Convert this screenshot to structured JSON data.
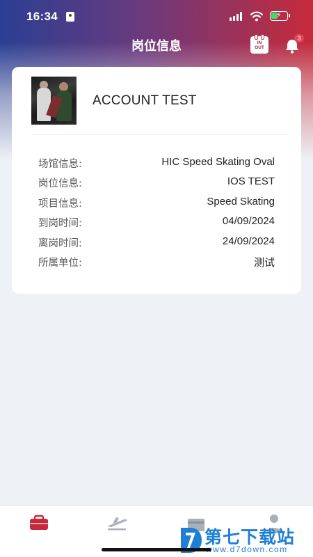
{
  "status_bar": {
    "time": "16:34"
  },
  "header": {
    "title": "岗位信息",
    "calendar_icon_text_top": "IN",
    "calendar_icon_text_bottom": "OUT",
    "notification_count": "3"
  },
  "profile": {
    "name": "ACCOUNT TEST"
  },
  "info": [
    {
      "label": "场馆信息:",
      "value": "HIC Speed Skating Oval"
    },
    {
      "label": "岗位信息:",
      "value": "IOS TEST"
    },
    {
      "label": "项目信息:",
      "value": "Speed Skating"
    },
    {
      "label": "到岗时间:",
      "value": "04/09/2024"
    },
    {
      "label": "离岗时间:",
      "value": "24/09/2024"
    },
    {
      "label": "所属单位:",
      "value": "测试"
    }
  ],
  "tabs": [
    {
      "icon": "briefcase-icon",
      "active": true
    },
    {
      "icon": "plane-icon",
      "active": false
    },
    {
      "icon": "card-icon",
      "active": false
    },
    {
      "icon": "person-icon",
      "active": false
    }
  ],
  "watermark": {
    "title": "第七下载站",
    "url": "www.d7down.com"
  },
  "colors": {
    "accent": "#c62a3a",
    "header_left": "#2a3f93",
    "header_right": "#c62a3a"
  }
}
